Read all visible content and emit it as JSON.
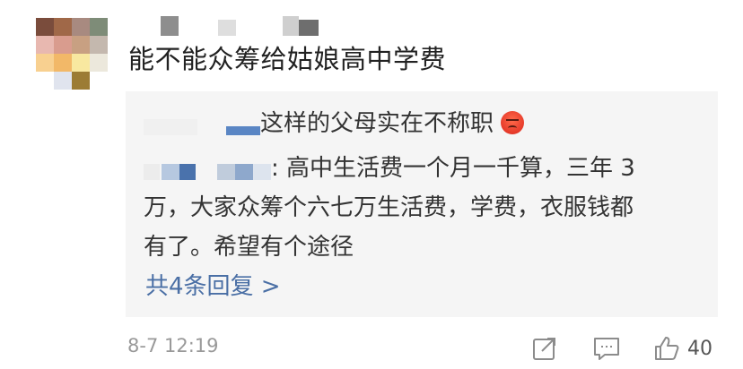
{
  "comment": {
    "text": "能不能众筹给姑娘高中学费",
    "timestamp": "8-7 12:19",
    "like_count": "40"
  },
  "replies": [
    {
      "text": "这样的父母实在不称职",
      "emoji": "angry-face-emoji"
    },
    {
      "first_line": ": 高中生活费一个月一千算，三年 3",
      "line2": "万，大家众筹个六七万生活费，学费，衣服钱都",
      "line3": "有了。希望有个途径"
    }
  ],
  "more_replies_label": "共4条回复 >",
  "colors": {
    "link": "#4a6fa5",
    "muted": "#999999",
    "panel_bg": "#f5f5f5",
    "text": "#222222"
  },
  "icons": {
    "share": "share-icon",
    "comment": "comment-icon",
    "like": "thumbs-up-icon"
  }
}
